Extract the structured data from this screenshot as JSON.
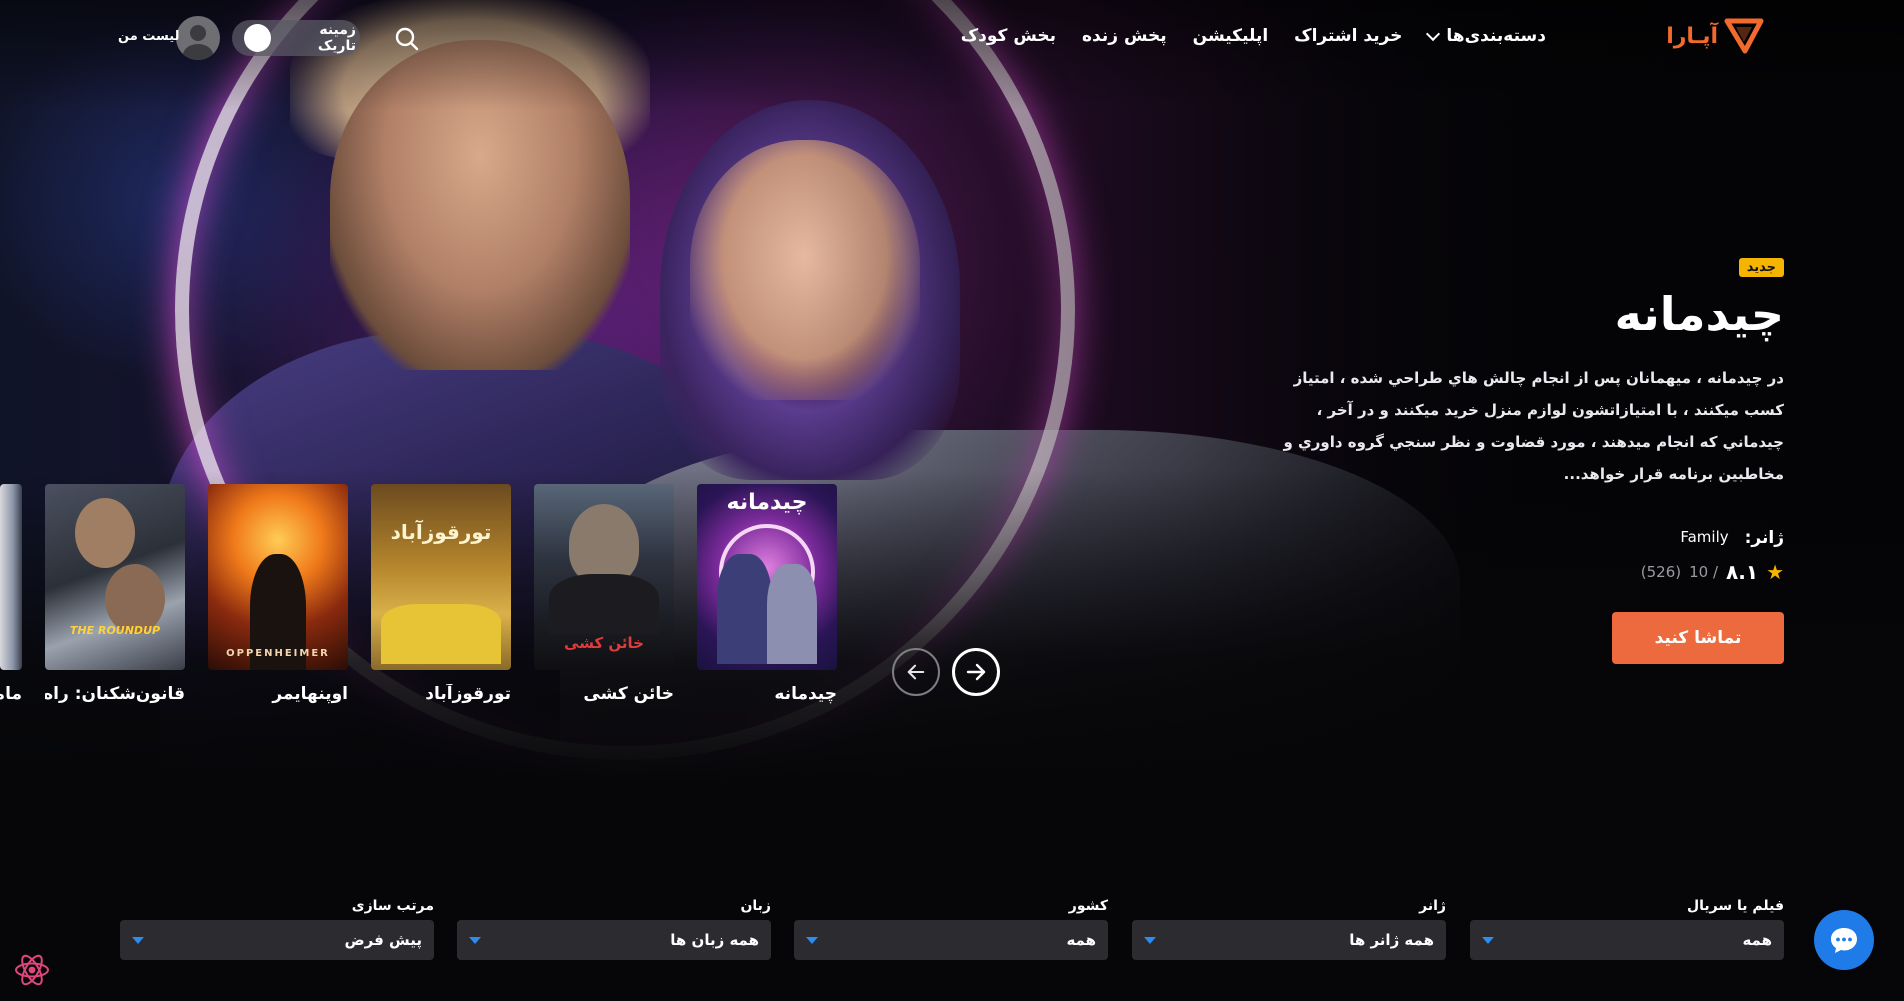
{
  "brand": {
    "logo_text": "آپـارا",
    "accent_color": "#ec6a3e"
  },
  "header": {
    "nav": [
      {
        "label": "دسته‌بندی‌ها",
        "has_dropdown": true
      },
      {
        "label": "خرید اشتراک"
      },
      {
        "label": "اپلیکیشن"
      },
      {
        "label": "پخش زنده"
      },
      {
        "label": "بخش کودک"
      }
    ],
    "theme_toggle_label": "زمینه تاریک",
    "my_list_label": "لیست من"
  },
  "hero": {
    "badge": "جدید",
    "title": "چیدمانه",
    "description": "در چیدمانه ، میهمانان پس از انجام چالش هاي طراحي شده ، امتیاز کسب میکنند ، با امتیازاتشون لوازم منزل خرید میکنند و در آخر ، چیدماني که انجام میدهند ، مورد قضاوت و نظر سنجي گروه داوري و مخاطبین برنامه قرار خواهد...",
    "genre_label": "ژانر:",
    "genre_value": "Family",
    "rating": {
      "value": "۸.۱",
      "max": "/ 10",
      "count": "(526)"
    },
    "watch_button": "تماشا کنید"
  },
  "carousel": {
    "items": [
      {
        "title": "چیدمانه",
        "poster_text": "چیدمانه"
      },
      {
        "title": "خائن کشی",
        "poster_text": "خائن کشی"
      },
      {
        "title": "تورقوزآباد",
        "poster_text": "تورقوزآباد"
      },
      {
        "title": "اوپنهایمر",
        "poster_text": "OPPENHEIMER"
      },
      {
        "title": "قانون‌شکنان: راه...",
        "poster_text": "THE ROUNDUP"
      },
      {
        "title": "ماموریت",
        "poster_text": ""
      }
    ]
  },
  "filters": [
    {
      "label": "فیلم یا سریال",
      "value": "همه"
    },
    {
      "label": "ژانر",
      "value": "همه ژانر ها"
    },
    {
      "label": "کشور",
      "value": "همه"
    },
    {
      "label": "زبان",
      "value": "همه زبان ها"
    },
    {
      "label": "مرتب سازی",
      "value": "پیش فرض"
    }
  ]
}
